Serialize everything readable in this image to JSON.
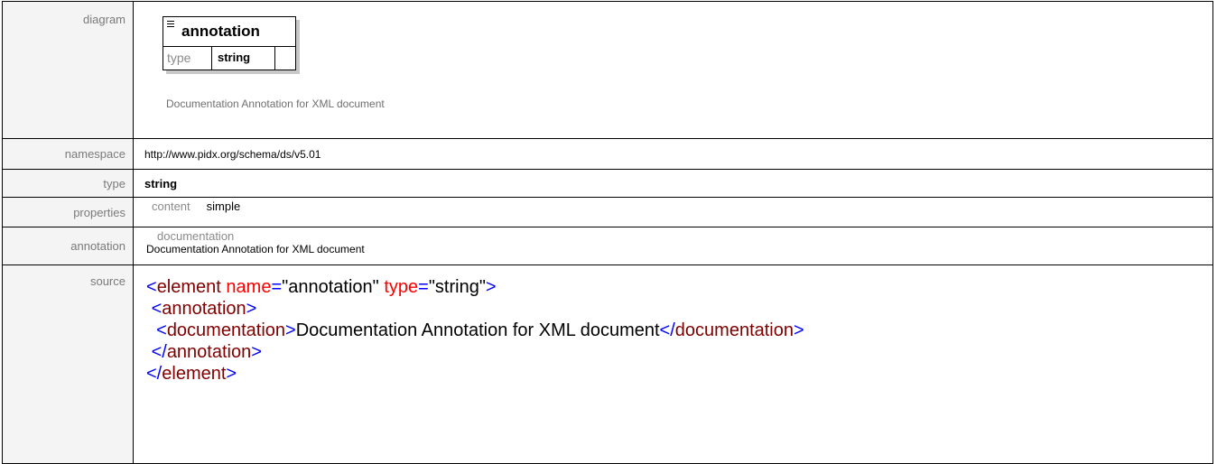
{
  "labels": {
    "diagram": "diagram",
    "namespace": "namespace",
    "type": "type",
    "properties": "properties",
    "annotation": "annotation",
    "source": "source"
  },
  "diagram": {
    "element_name": "annotation",
    "type_label": "type",
    "type_value": "string",
    "caption": "Documentation Annotation for XML document"
  },
  "namespace": "http://www.pidx.org/schema/ds/v5.01",
  "type": "string",
  "properties": {
    "key": "content",
    "value": "simple"
  },
  "annotation": {
    "key": "documentation",
    "value": "Documentation Annotation for XML document"
  },
  "source": {
    "l1": {
      "open": "<",
      "tag": "element",
      "attr1": "name",
      "eq1": "=",
      "val1": "\"annotation\"",
      "attr2": "type",
      "eq2": "=",
      "val2": "\"string\"",
      "close": ">"
    },
    "l2": {
      "indent": " ",
      "open": "<",
      "tag": "annotation",
      "close": ">"
    },
    "l3": {
      "indent": "  ",
      "open": "<",
      "tag": "documentation",
      "close": ">",
      "text": "Documentation Annotation for XML document",
      "endopen": "</",
      "endtag": "documentation",
      "endclose": ">"
    },
    "l4": {
      "indent": " ",
      "open": "</",
      "tag": "annotation",
      "close": ">"
    },
    "l5": {
      "open": "</",
      "tag": "element",
      "close": ">"
    }
  },
  "colors": {
    "bracket": "#0000ff",
    "tag": "#800000",
    "attribute": "#ff0000",
    "label_bg": "#f4f4f4",
    "label_text": "#7a7a7a"
  }
}
